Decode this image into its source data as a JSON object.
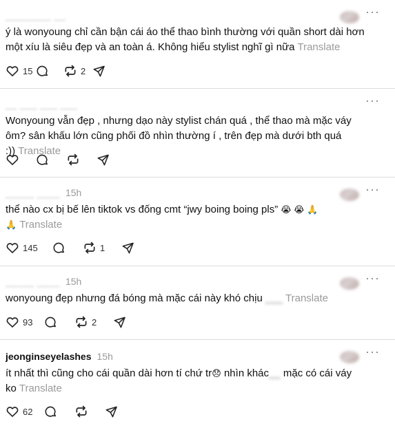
{
  "translate_label": "Translate",
  "more_label": "···",
  "posts": [
    {
      "username": "________  __",
      "time": "",
      "text": "ý là wonyoung chỉ cần bận cái áo thể thao bình thường với quần short dài hơn một xíu là siêu đẹp và an toàn á. Không hiểu stylist nghĩ gì nữa",
      "likes": "15",
      "reposts": "2"
    },
    {
      "username": "__ ___ ___  ___",
      "time": "",
      "text": "Wonyoung vẫn đẹp , nhưng dạo này stylist chán quá , thể thao mà mặc váy ôm? sân khấu lớn cũng phối đồ nhìn thường í , trên đẹp mà dưới bth quá :))",
      "likes": "",
      "reposts": ""
    },
    {
      "username": "_____ ____",
      "time": "15h",
      "text": "thể nào cx bị bế lên tiktok vs đống cmt “jwy boing boing pls”",
      "emojis": "😭 😭 🙏",
      "emoji_line2": "🙏",
      "likes": "145",
      "reposts": "1"
    },
    {
      "username": "_____ ____",
      "time": "15h",
      "text": "wonyoung đẹp nhưng đá bóng mà mặc cái này khó chịu",
      "blurred": "___",
      "likes": "93",
      "reposts": "2"
    },
    {
      "username": "jeonginseyelashes",
      "time": "15h",
      "text_a": "ít nhất thì cũng cho cái quần dài hơn tí chứ tr",
      "emoji_a": "😞",
      "text_b": "nhìn khác",
      "blurred": "__",
      "text_c": "mặc có cái váy ko",
      "likes": "62",
      "reposts": ""
    }
  ]
}
